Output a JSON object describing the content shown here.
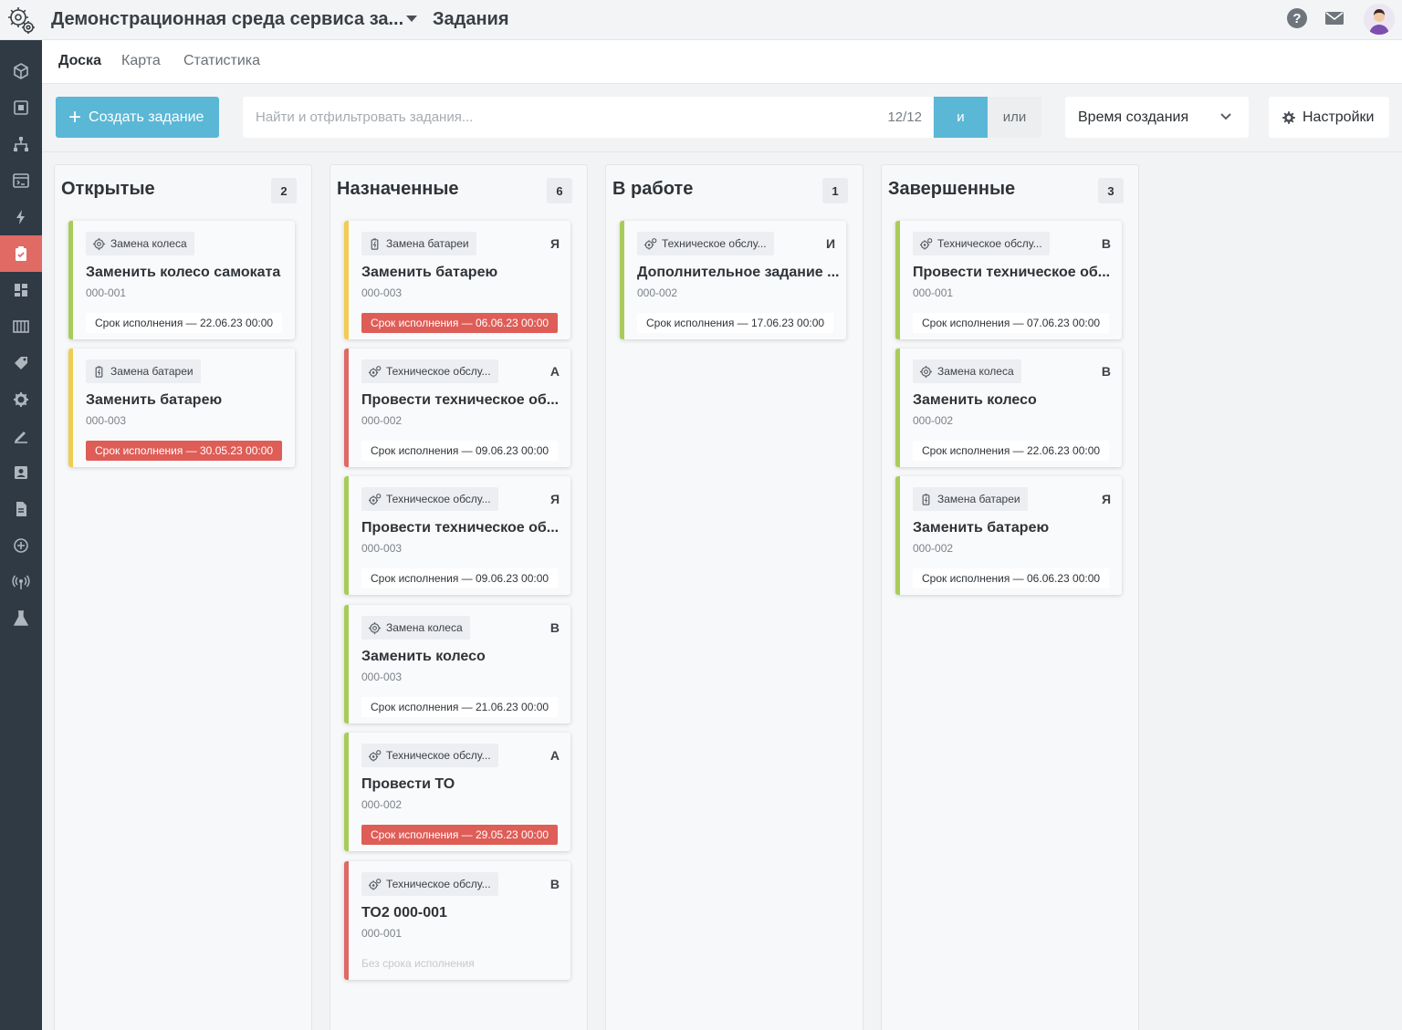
{
  "header": {
    "app_title": "Демонстрационная среда сервиса за...",
    "page_title": "Задания",
    "help": "?"
  },
  "tabs": [
    {
      "label": "Доска",
      "active": true
    },
    {
      "label": "Карта",
      "active": false
    },
    {
      "label": "Статистика",
      "active": false
    }
  ],
  "toolbar": {
    "create_label": "Создать задание",
    "search_placeholder": "Найти и отфильтровать задания...",
    "search_count": "12/12",
    "and_label": "и",
    "or_label": "или",
    "sort_value": "Время создания",
    "settings_label": "Настройки"
  },
  "colors": {
    "accent": "#5bb7d6",
    "sidebar": "#2f3a45",
    "active_nav": "#e06a64",
    "green": "#a8cc5a",
    "yellow": "#f1cc52",
    "red": "#de6a64",
    "overdue": "#de5d57"
  },
  "columns": [
    {
      "title": "Открытые",
      "count": "2",
      "cards": [
        {
          "type": "Замена колеса",
          "type_icon": "wheel-gear-icon",
          "assignee": "",
          "title": "Заменить колесо самоката",
          "id": "000-001",
          "due": "Срок исполнения — 22.06.23 00:00",
          "due_state": "normal",
          "stripe": "green"
        },
        {
          "type": "Замена батареи",
          "type_icon": "battery-icon",
          "assignee": "",
          "title": "Заменить батарею",
          "id": "000-003",
          "due": "Срок исполнения — 30.05.23 00:00",
          "due_state": "overdue",
          "stripe": "yellow"
        }
      ]
    },
    {
      "title": "Назначенные",
      "count": "6",
      "cards": [
        {
          "type": "Замена батареи",
          "type_icon": "battery-icon",
          "assignee": "Я",
          "title": "Заменить батарею",
          "id": "000-003",
          "due": "Срок исполнения — 06.06.23 00:00",
          "due_state": "overdue",
          "stripe": "yellow"
        },
        {
          "type": "Техническое обслу...",
          "type_icon": "gears-icon",
          "assignee": "А",
          "title": "Провести техническое об...",
          "id": "000-002",
          "due": "Срок исполнения — 09.06.23 00:00",
          "due_state": "normal",
          "stripe": "red"
        },
        {
          "type": "Техническое обслу...",
          "type_icon": "gears-icon",
          "assignee": "Я",
          "title": "Провести техническое об...",
          "id": "000-003",
          "due": "Срок исполнения — 09.06.23 00:00",
          "due_state": "normal",
          "stripe": "green"
        },
        {
          "type": "Замена колеса",
          "type_icon": "wheel-gear-icon",
          "assignee": "В",
          "title": "Заменить колесо",
          "id": "000-003",
          "due": "Срок исполнения — 21.06.23 00:00",
          "due_state": "normal",
          "stripe": "green"
        },
        {
          "type": "Техническое обслу...",
          "type_icon": "gears-icon",
          "assignee": "А",
          "title": "Провести ТО",
          "id": "000-002",
          "due": "Срок исполнения — 29.05.23 00:00",
          "due_state": "overdue",
          "stripe": "green"
        },
        {
          "type": "Техническое обслу...",
          "type_icon": "gears-icon",
          "assignee": "В",
          "title": "ТО2 000-001",
          "id": "000-001",
          "due": "Без срока исполнения",
          "due_state": "none",
          "stripe": "red"
        }
      ]
    },
    {
      "title": "В работе",
      "count": "1",
      "cards": [
        {
          "type": "Техническое обслу...",
          "type_icon": "gears-icon",
          "assignee": "И",
          "title": "Дополнительное задание ...",
          "id": "000-002",
          "due": "Срок исполнения — 17.06.23 00:00",
          "due_state": "normal",
          "stripe": "green"
        }
      ]
    },
    {
      "title": "Завершенные",
      "count": "3",
      "cards": [
        {
          "type": "Техническое обслу...",
          "type_icon": "gears-icon",
          "assignee": "В",
          "title": "Провести техническое об...",
          "id": "000-001",
          "due": "Срок исполнения — 07.06.23 00:00",
          "due_state": "normal",
          "stripe": "green"
        },
        {
          "type": "Замена колеса",
          "type_icon": "wheel-gear-icon",
          "assignee": "В",
          "title": "Заменить колесо",
          "id": "000-002",
          "due": "Срок исполнения — 22.06.23 00:00",
          "due_state": "normal",
          "stripe": "green"
        },
        {
          "type": "Замена батареи",
          "type_icon": "battery-icon",
          "assignee": "Я",
          "title": "Заменить батарею",
          "id": "000-002",
          "due": "Срок исполнения — 06.06.23 00:00",
          "due_state": "normal",
          "stripe": "green"
        }
      ]
    }
  ],
  "sidebar": {
    "items": [
      {
        "icon": "box-icon",
        "active": false
      },
      {
        "icon": "frame-icon",
        "active": false
      },
      {
        "icon": "hierarchy-icon",
        "active": false
      },
      {
        "icon": "terminal-window-icon",
        "active": false
      },
      {
        "icon": "lightning-icon",
        "active": false
      },
      {
        "icon": "clipboard-check-icon",
        "active": true
      },
      {
        "icon": "dashboard-icon",
        "active": false
      },
      {
        "icon": "table-icon",
        "active": false
      },
      {
        "icon": "tag-icon",
        "active": false
      },
      {
        "icon": "settings-cog-icon",
        "active": false
      },
      {
        "icon": "pen-tool-icon",
        "active": false
      },
      {
        "icon": "user-card-icon",
        "active": false
      },
      {
        "icon": "document-icon",
        "active": false
      },
      {
        "icon": "plus-circle-icon",
        "active": false
      },
      {
        "icon": "broadcast-icon",
        "active": false
      },
      {
        "icon": "flask-icon",
        "active": false
      }
    ]
  }
}
